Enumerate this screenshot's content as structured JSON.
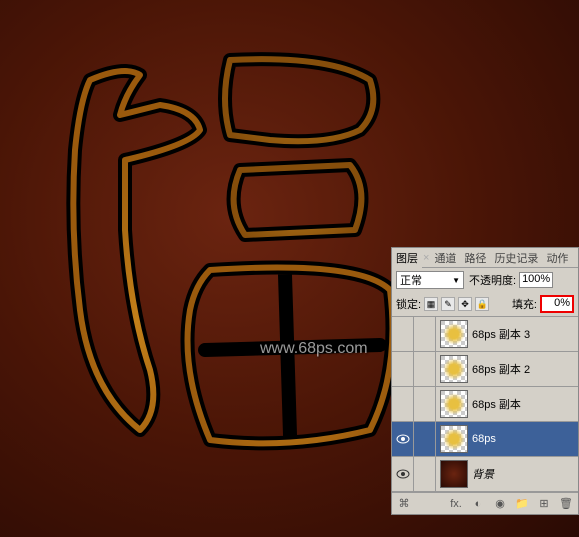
{
  "watermark": "www.68ps.com",
  "panel": {
    "tabs": {
      "layers": "图层",
      "channels": "通道",
      "paths": "路径",
      "history": "历史记录",
      "actions": "动作"
    },
    "blend": {
      "mode": "正常",
      "opacityLabel": "不透明度:",
      "opacityValue": "100%"
    },
    "lock": {
      "label": "锁定:",
      "fillLabel": "填充:",
      "fillValue": "0%"
    },
    "layers": [
      {
        "name": "68ps 副本 3",
        "visible": false,
        "selected": false
      },
      {
        "name": "68ps 副本 2",
        "visible": false,
        "selected": false
      },
      {
        "name": "68ps 副本",
        "visible": false,
        "selected": false
      },
      {
        "name": "68ps",
        "visible": true,
        "selected": true
      },
      {
        "name": "背景",
        "visible": true,
        "selected": false,
        "italic": true,
        "isBg": true
      }
    ],
    "footerStyle": "fx."
  }
}
